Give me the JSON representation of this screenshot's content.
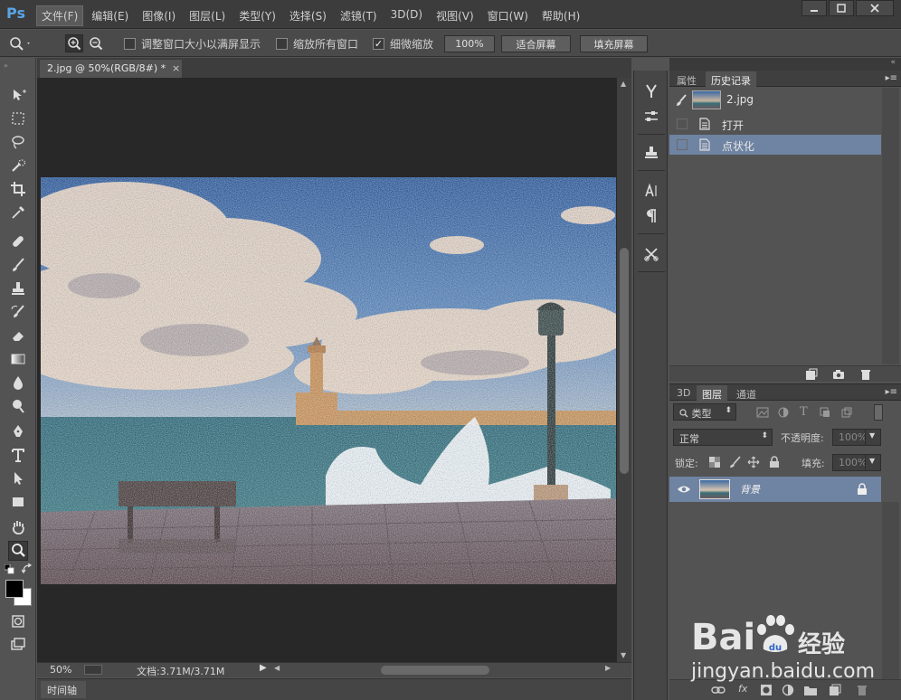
{
  "app": {
    "logo": "Ps",
    "menus": [
      "文件(F)",
      "编辑(E)",
      "图像(I)",
      "图层(L)",
      "类型(Y)",
      "选择(S)",
      "滤镜(T)",
      "3D(D)",
      "视图(V)",
      "窗口(W)",
      "帮助(H)"
    ],
    "active_menu_index": 0
  },
  "options": {
    "resize_windows": "调整窗口大小以满屏显示",
    "zoom_all": "缩放所有窗口",
    "scrubby_zoom": "细微缩放",
    "scrubby_zoom_checked": true,
    "btn_100": "100%",
    "btn_fit": "适合屏幕",
    "btn_fill": "填充屏幕"
  },
  "document": {
    "tab_title": "2.jpg @ 50%(RGB/8#) *",
    "close_glyph": "×"
  },
  "status": {
    "zoom": "50%",
    "doc_info": "文档:3.71M/3.71M"
  },
  "timeline": {
    "label": "时间轴"
  },
  "history_panel": {
    "tabs": [
      "属性",
      "历史记录"
    ],
    "active_tab": 1,
    "snapshot_name": "2.jpg",
    "steps": [
      {
        "label": "打开",
        "selected": false
      },
      {
        "label": "点状化",
        "selected": true
      }
    ]
  },
  "layers_panel": {
    "tabs": [
      "3D",
      "图层",
      "通道"
    ],
    "active_tab": 1,
    "filter_kind": "类型",
    "blend_mode": "正常",
    "opacity_label": "不透明度:",
    "opacity_value": "100%",
    "lock_label": "锁定:",
    "fill_label": "填充:",
    "fill_value": "100%",
    "layers": [
      {
        "name": "背景",
        "visible": true,
        "locked": true
      }
    ]
  },
  "watermark": {
    "brand": "Bai",
    "brand_cn": "经验",
    "url": "jingyan.baidu.com"
  },
  "colors": {
    "foreground": "#000000",
    "background": "#ffffff",
    "selection": "#6f83a2",
    "ps_blue": "#5aa4e6"
  }
}
